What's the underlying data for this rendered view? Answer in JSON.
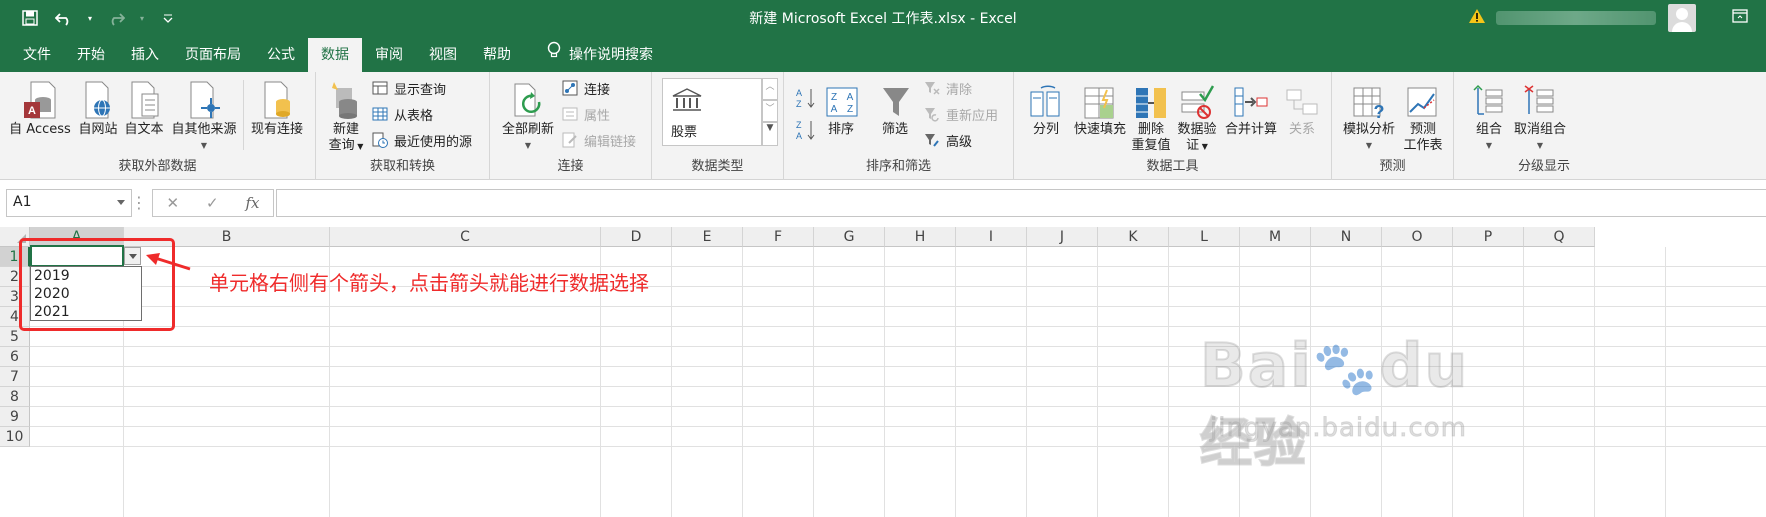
{
  "title": "新建 Microsoft Excel 工作表.xlsx  -  Excel",
  "qat": {
    "icons": [
      "save-icon",
      "undo-icon",
      "redo-icon",
      "customize-qat-icon"
    ]
  },
  "tabs": [
    {
      "label": "文件",
      "active": false
    },
    {
      "label": "开始",
      "active": false
    },
    {
      "label": "插入",
      "active": false
    },
    {
      "label": "页面布局",
      "active": false
    },
    {
      "label": "公式",
      "active": false
    },
    {
      "label": "数据",
      "active": true
    },
    {
      "label": "审阅",
      "active": false
    },
    {
      "label": "视图",
      "active": false
    },
    {
      "label": "帮助",
      "active": false
    }
  ],
  "tell_me": "操作说明搜索",
  "ribbon": {
    "get_external": {
      "label": "获取外部数据",
      "buttons": [
        "自 Access",
        "自网站",
        "自文本",
        "自其他来源",
        "现有连接"
      ]
    },
    "get_transform": {
      "label": "获取和转换",
      "new_query_1": "新建",
      "new_query_2": "查询",
      "show_queries": "显示查询",
      "from_table": "从表格",
      "recent_sources": "最近使用的源"
    },
    "connections": {
      "label": "连接",
      "refresh_all": "全部刷新",
      "connections": "连接",
      "properties": "属性",
      "edit_links": "编辑链接"
    },
    "data_types": {
      "label": "数据类型",
      "stocks": "股票"
    },
    "sort_filter": {
      "label": "排序和筛选",
      "sort": "排序",
      "filter": "筛选",
      "clear": "清除",
      "reapply": "重新应用",
      "advanced": "高级"
    },
    "data_tools": {
      "label": "数据工具",
      "text_to_columns": "分列",
      "flash_fill": "快速填充",
      "remove_dup_1": "删除",
      "remove_dup_2": "重复值",
      "validation_1": "数据验",
      "validation_2": "证",
      "consolidate": "合并计算",
      "relationships": "关系"
    },
    "forecast": {
      "label": "预测",
      "what_if": "模拟分析",
      "forecast_1": "预测",
      "forecast_2": "工作表"
    },
    "outline": {
      "label": "分级显示",
      "group": "组合",
      "ungroup": "取消组合"
    }
  },
  "formula_bar": {
    "name_box": "A1",
    "fx": "fx",
    "formula": ""
  },
  "columns": [
    "A",
    "B",
    "C",
    "D",
    "E",
    "F",
    "G",
    "H",
    "I",
    "J",
    "K",
    "L",
    "M",
    "N",
    "O",
    "P",
    "Q"
  ],
  "rows": [
    "1",
    "2",
    "3",
    "4",
    "5",
    "6",
    "7",
    "8",
    "9",
    "10"
  ],
  "dropdown_items": [
    "2019",
    "2020",
    "2021"
  ],
  "annotation": "单元格右侧有个箭头，点击箭头就能进行数据选择",
  "watermark": {
    "main": "Bai",
    "brand": "du",
    "cn": "经验",
    "sub": "jingyan.baidu.com"
  },
  "colors": {
    "excel_green": "#217346",
    "annotation_red": "#ef2b2b"
  }
}
